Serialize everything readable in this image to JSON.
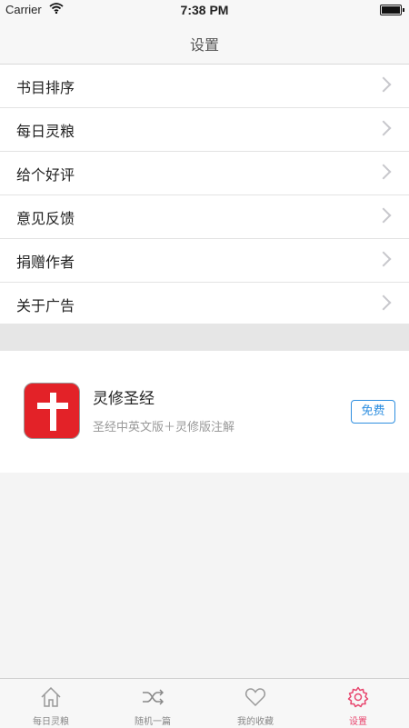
{
  "status_bar": {
    "carrier": "Carrier",
    "time": "7:38 PM"
  },
  "nav": {
    "title": "设置"
  },
  "menu": {
    "items": [
      {
        "label": "书目排序"
      },
      {
        "label": "每日灵粮"
      },
      {
        "label": "给个好评"
      },
      {
        "label": "意见反馈"
      },
      {
        "label": "捐赠作者"
      },
      {
        "label": "关于广告"
      }
    ]
  },
  "promo": {
    "app_name": "灵修圣经",
    "subtitle": "圣经中英文版＋灵修版注解",
    "button": "免费",
    "icon_color": "#e32228"
  },
  "tabbar": {
    "tabs": [
      {
        "label": "每日灵粮",
        "icon": "home-icon"
      },
      {
        "label": "随机一篇",
        "icon": "shuffle-icon"
      },
      {
        "label": "我的收藏",
        "icon": "heart-icon"
      },
      {
        "label": "设置",
        "icon": "gear-icon",
        "active": true
      }
    ],
    "active_color": "#e8466e"
  }
}
